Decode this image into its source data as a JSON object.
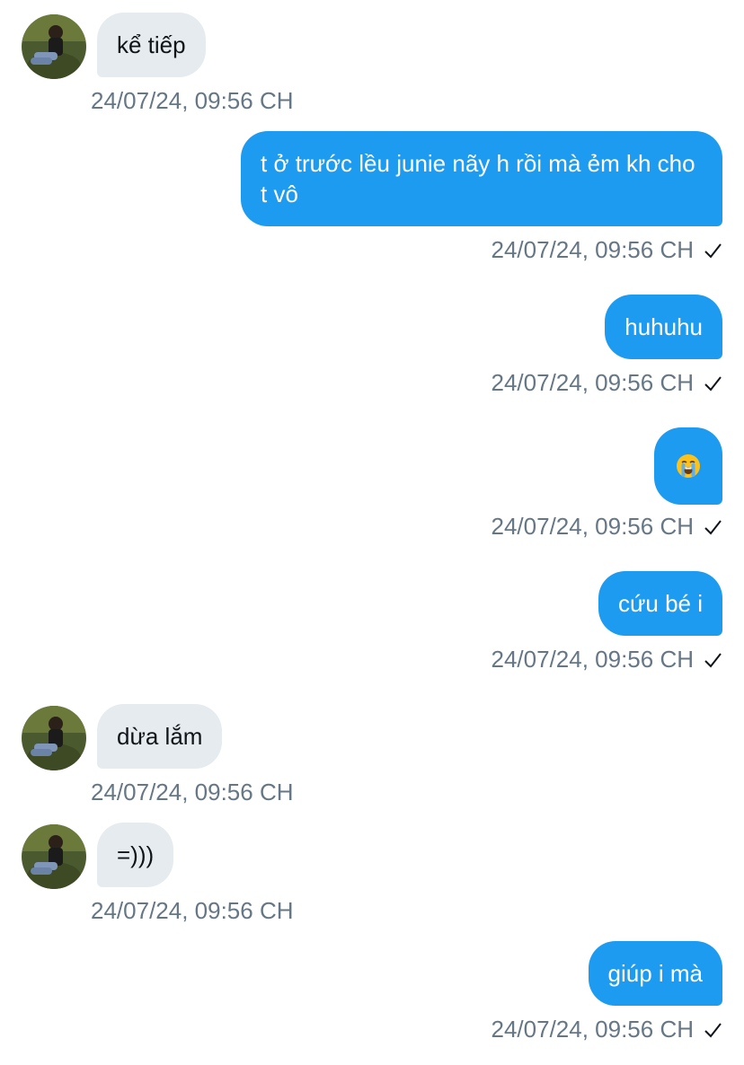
{
  "messages": [
    {
      "sender": "other",
      "text": "kể tiếp",
      "timestamp": "24/07/24, 09:56 CH"
    },
    {
      "sender": "me",
      "text": "t ở trước lều junie nãy h rồi mà ẻm kh cho t vô",
      "timestamp": "24/07/24, 09:56 CH"
    },
    {
      "sender": "me",
      "text": "huhuhu",
      "timestamp": "24/07/24, 09:56 CH"
    },
    {
      "sender": "me",
      "text": "",
      "emoji": "loudly-crying-face-emoji",
      "timestamp": "24/07/24, 09:56 CH"
    },
    {
      "sender": "me",
      "text": "cứu bé i",
      "timestamp": "24/07/24, 09:56 CH"
    },
    {
      "sender": "other",
      "text": "dừa lắm",
      "timestamp": "24/07/24, 09:56 CH"
    },
    {
      "sender": "other",
      "text": "=)))",
      "timestamp": "24/07/24, 09:56 CH"
    },
    {
      "sender": "me",
      "text": "giúp i mà",
      "timestamp": "24/07/24, 09:56 CH"
    }
  ],
  "colors": {
    "outgoing_bubble": "#1d9bf0",
    "incoming_bubble": "#e6ebef",
    "timestamp_text": "#657786"
  },
  "icons": {
    "read_receipt": "checkmark-icon",
    "contact_avatar": "avatar"
  }
}
